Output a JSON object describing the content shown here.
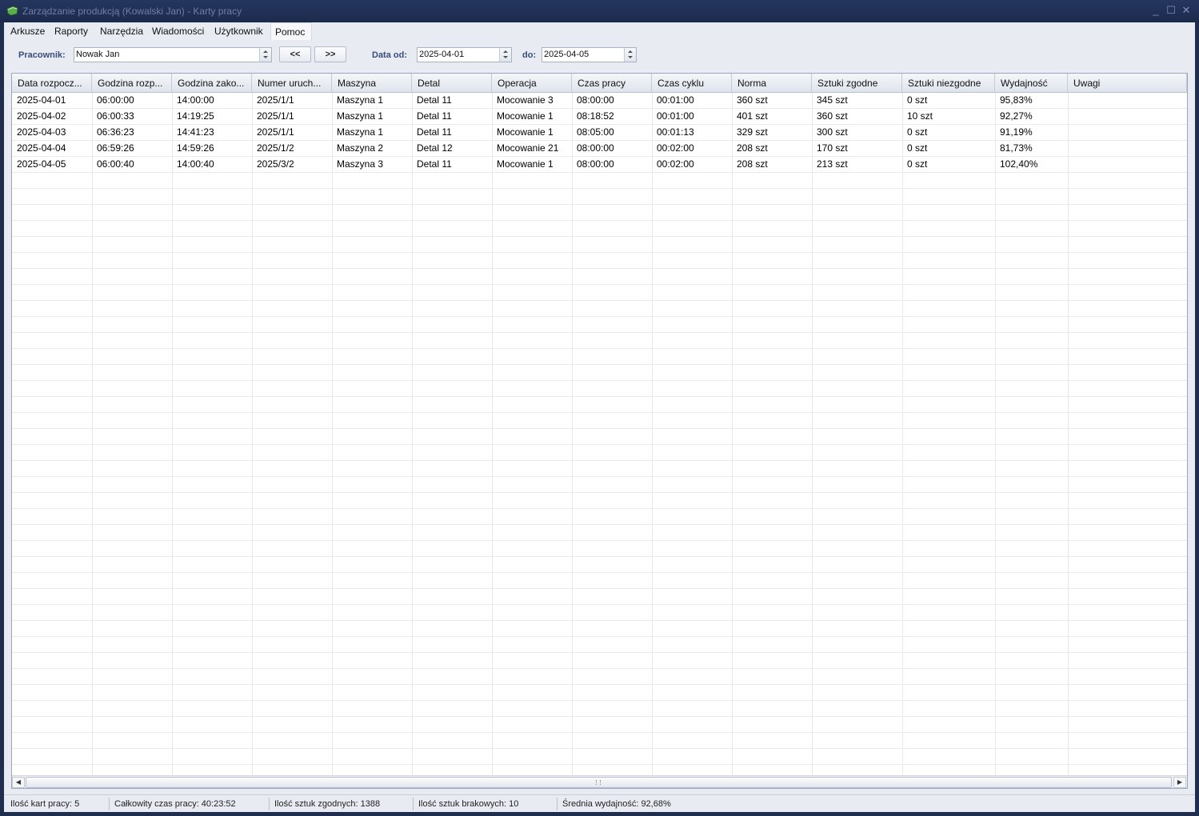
{
  "window": {
    "title": "Zarządzanie produkcją (Kowalski Jan) - Karty pracy",
    "controls": {
      "minimize": "_",
      "maximize": "☐",
      "close": "✕"
    }
  },
  "menu": [
    {
      "label": "Arkusze"
    },
    {
      "label": "Raporty"
    },
    {
      "label": "Narzędzia"
    },
    {
      "label": "Wiadomości"
    },
    {
      "label": "Użytkownik"
    },
    {
      "label": "Pomoc"
    }
  ],
  "toolbar": {
    "employee_label": "Pracownik:",
    "employee_value": "Nowak Jan",
    "prev_label": "<<",
    "next_label": ">>",
    "date_from_label": "Data od:",
    "date_from_value": "2025-04-01",
    "date_to_label": "do:",
    "date_to_value": "2025-04-05"
  },
  "grid": {
    "columns": [
      "Data rozpocz...",
      "Godzina rozp...",
      "Godzina zako...",
      "Numer uruch...",
      "Maszyna",
      "Detal",
      "Operacja",
      "Czas pracy",
      "Czas cyklu",
      "Norma",
      "Sztuki zgodne",
      "Sztuki niezgodne",
      "Wydajność",
      "Uwagi"
    ],
    "rows": [
      [
        "2025-04-01",
        "06:00:00",
        "14:00:00",
        "2025/1/1",
        "Maszyna 1",
        "Detal 11",
        "Mocowanie 3",
        "08:00:00",
        "00:01:00",
        "360 szt",
        "345 szt",
        "0 szt",
        "95,83%",
        ""
      ],
      [
        "2025-04-02",
        "06:00:33",
        "14:19:25",
        "2025/1/1",
        "Maszyna 1",
        "Detal 11",
        "Mocowanie 1",
        "08:18:52",
        "00:01:00",
        "401 szt",
        "360 szt",
        "10 szt",
        "92,27%",
        ""
      ],
      [
        "2025-04-03",
        "06:36:23",
        "14:41:23",
        "2025/1/1",
        "Maszyna 1",
        "Detal 11",
        "Mocowanie 1",
        "08:05:00",
        "00:01:13",
        "329 szt",
        "300 szt",
        "0 szt",
        "91,19%",
        ""
      ],
      [
        "2025-04-04",
        "06:59:26",
        "14:59:26",
        "2025/1/2",
        "Maszyna 2",
        "Detal 12",
        "Mocowanie 21",
        "08:00:00",
        "00:02:00",
        "208 szt",
        "170 szt",
        "0 szt",
        "81,73%",
        ""
      ],
      [
        "2025-04-05",
        "06:00:40",
        "14:00:40",
        "2025/3/2",
        "Maszyna 3",
        "Detal 11",
        "Mocowanie 1",
        "08:00:00",
        "00:02:00",
        "208 szt",
        "213 szt",
        "0 szt",
        "102,40%",
        ""
      ]
    ]
  },
  "status": [
    {
      "label": "Ilość kart pracy: 5"
    },
    {
      "label": "Całkowity czas pracy: 40:23:52"
    },
    {
      "label": "Ilość sztuk zgodnych: 1388"
    },
    {
      "label": "Ilość sztuk brakowych: 10"
    },
    {
      "label": "Średnia wydajność: 92,68%"
    }
  ],
  "colors": {
    "frame": "#1f2d4e",
    "client_bg": "#e8ebf1",
    "label_accent": "#3a4d7a"
  }
}
